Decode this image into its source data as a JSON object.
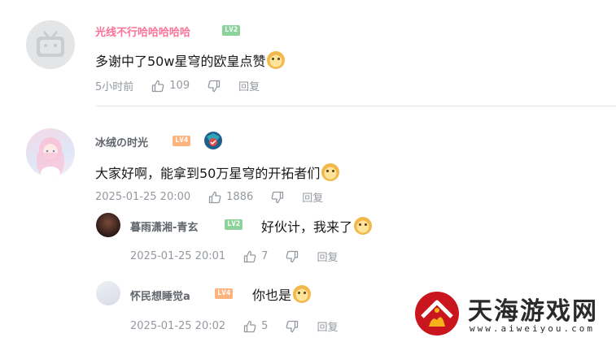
{
  "comments": [
    {
      "username": "光线不行哈哈哈哈哈",
      "level": "LV2",
      "text": "多谢中了50w星穹的欧皇点赞",
      "time": "5小时前",
      "likes": "109",
      "reply_label": "回复",
      "username_color": "#fb7299"
    },
    {
      "username": "冰绒の时光",
      "level": "LV4",
      "text": "大家好啊，能拿到50万星穹的开拓者们",
      "time": "2025-01-25 20:00",
      "likes": "1886",
      "reply_label": "回复",
      "username_color": "#61666d"
    }
  ],
  "replies": [
    {
      "username": "暮雨潇湘-青玄",
      "level": "LV2",
      "text": "好伙计，我来了",
      "time": "2025-01-25 20:01",
      "likes": "7",
      "reply_label": "回复"
    },
    {
      "username": "怀民想睡觉a",
      "level": "LV4",
      "text": "你也是",
      "time": "2025-01-25 20:02",
      "likes": "5",
      "reply_label": "回复"
    }
  ],
  "watermark": {
    "title": "天海游戏网",
    "url": "www.aiweiyou.com"
  },
  "icons": [
    "thumbs-up-icon",
    "thumbs-down-icon",
    "emoji-icon",
    "tv-avatar-icon",
    "badge-icon"
  ],
  "colors": {
    "accent_pink": "#fb7299",
    "level2": "#8bd29b",
    "level4": "#ffb37c",
    "meta_gray": "#9499a0"
  }
}
